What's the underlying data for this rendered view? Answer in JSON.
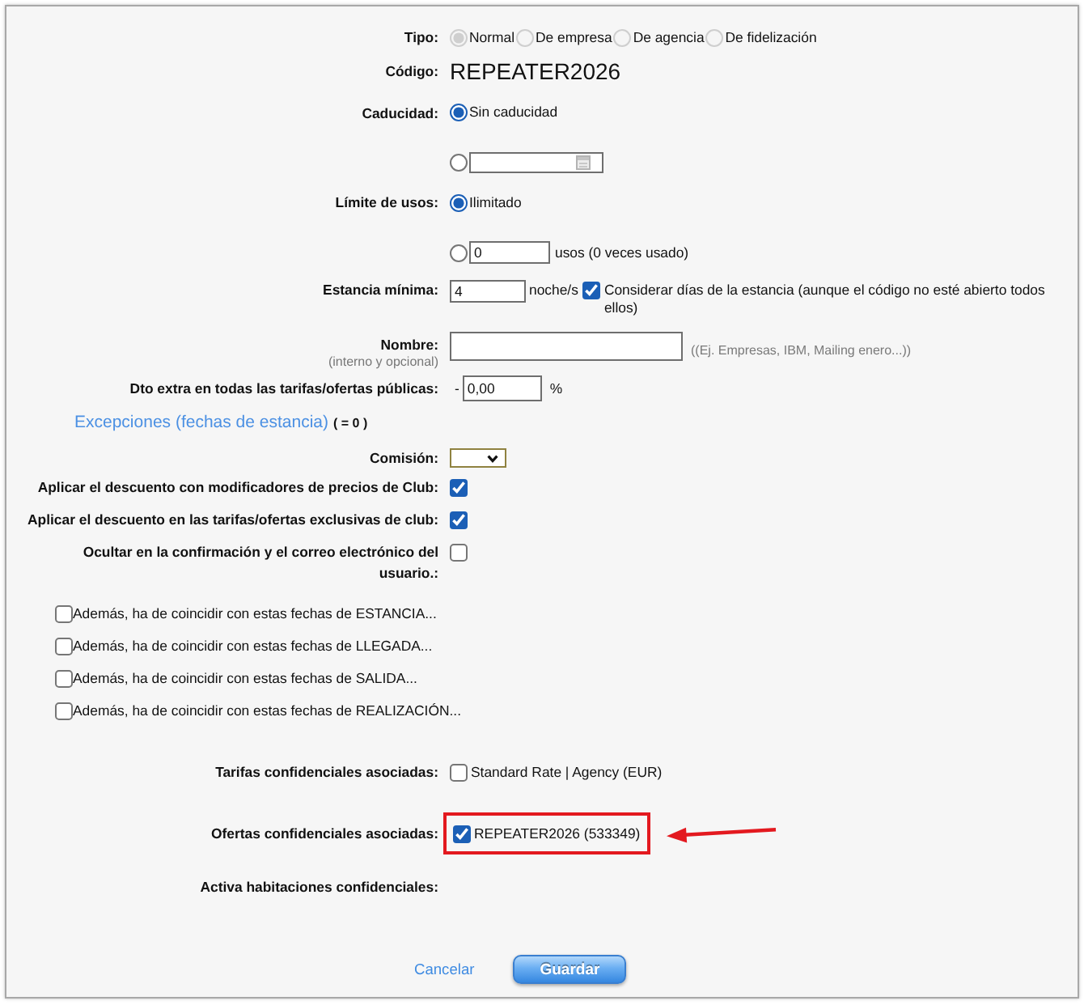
{
  "form": {
    "rows": [
      {
        "kind": "radio_group",
        "label": "Tipo:",
        "options": [
          {
            "label": "Normal",
            "selected": true,
            "disabled": true
          },
          {
            "label": "De empresa",
            "selected": false,
            "disabled": true
          },
          {
            "label": "De agencia",
            "selected": false,
            "disabled": true
          },
          {
            "label": "De fidelización",
            "selected": false,
            "disabled": true
          }
        ]
      },
      {
        "kind": "code",
        "label": "Código:",
        "value": "REPEATER2026"
      },
      {
        "kind": "choice",
        "label": "Caducidad:",
        "options": [
          {
            "kind": "text",
            "label": "Sin caducidad",
            "selected": true
          },
          {
            "kind": "date",
            "selected": false
          }
        ]
      },
      {
        "kind": "choice",
        "label": "Límite de usos:",
        "options": [
          {
            "kind": "text",
            "label": "Ilimitado",
            "selected": true
          },
          {
            "kind": "count",
            "selected": false,
            "value": "0",
            "unit": "usos (0 veces usado)"
          }
        ]
      },
      {
        "kind": "min_stay",
        "label": "Estancia mínima:",
        "value": "4",
        "unit": "noche/s",
        "checkbox": {
          "label": "Considerar días de la estancia (aunque el código no esté abierto todos ellos)",
          "checked": true
        }
      },
      {
        "kind": "name",
        "label": "Nombre:",
        "sublabel": "(interno y opcional)",
        "hint": "((Ej. Empresas, IBM, Mailing enero...))"
      },
      {
        "kind": "percent",
        "label": "Dto extra en todas las tarifas/ofertas públicas:",
        "prefix": "-",
        "value": "0,00",
        "unit": "%"
      },
      {
        "kind": "link",
        "label": "Excepciones (fechas de estancia)",
        "count": "( = 0 )"
      },
      {
        "kind": "select",
        "label": "Comisión:"
      },
      {
        "kind": "checkbox",
        "label": "Aplicar el descuento con modificadores de precios de Club:",
        "checked": true
      },
      {
        "kind": "checkbox",
        "label": "Aplicar el descuento en las tarifas/ofertas exclusivas de club:",
        "checked": true
      },
      {
        "kind": "checkbox",
        "label": "Ocultar en la confirmación y el correo electrónico del usuario.:",
        "checked": false
      },
      {
        "kind": "filter",
        "label": "Además, ha de coincidir con estas fechas de ESTANCIA...",
        "checked": false
      },
      {
        "kind": "filter",
        "label": "Además, ha de coincidir con estas fechas de LLEGADA...",
        "checked": false
      },
      {
        "kind": "filter",
        "label": "Además, ha de coincidir con estas fechas de SALIDA...",
        "checked": false
      },
      {
        "kind": "filter",
        "label": "Además, ha de coincidir con estas fechas de REALIZACIÓN...",
        "checked": false
      },
      {
        "kind": "check_list",
        "label": "Tarifas confidenciales asociadas:",
        "items": [
          {
            "label": "Standard Rate | Agency (EUR)",
            "checked": false,
            "highlighted": false
          }
        ]
      },
      {
        "kind": "check_list",
        "label": "Ofertas confidenciales asociadas:",
        "items": [
          {
            "label": "REPEATER2026 (533349)",
            "checked": true,
            "highlighted": true
          }
        ]
      },
      {
        "kind": "check_list",
        "label": "Activa habitaciones confidenciales:"
      }
    ],
    "actions": [
      {
        "kind": "link",
        "label": "Cancelar"
      },
      {
        "kind": "button",
        "label": "Guardar"
      }
    ]
  }
}
